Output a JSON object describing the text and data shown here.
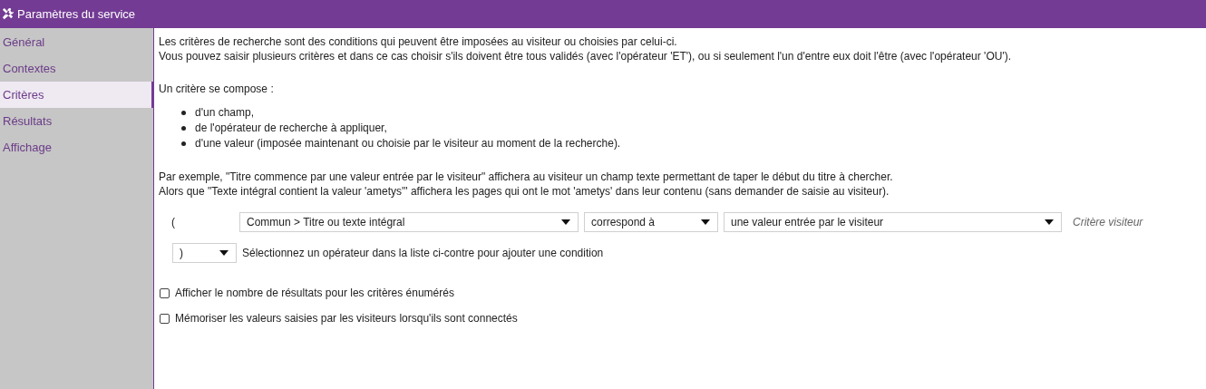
{
  "window": {
    "title": "Paramètres du service"
  },
  "sidebar": {
    "items": [
      {
        "label": "Général",
        "selected": false
      },
      {
        "label": "Contextes",
        "selected": false
      },
      {
        "label": "Critères",
        "selected": true
      },
      {
        "label": "Résultats",
        "selected": false
      },
      {
        "label": "Affichage",
        "selected": false
      }
    ]
  },
  "intro": [
    "Les critères de recherche sont des conditions qui peuvent être imposées au visiteur ou choisies par celui-ci.",
    "Vous pouvez saisir plusieurs critères et dans ce cas choisir s'ils doivent être tous validés (avec l'opérateur 'ET'), ou si seulement l'un d'entre eux doit l'être (avec l'opérateur 'OU')."
  ],
  "composition": {
    "heading": "Un critère se compose :",
    "items": [
      "d'un champ,",
      "de l'opérateur de recherche à appliquer,",
      "d'une valeur (imposée maintenant ou choisie par le visiteur au moment de la recherche)."
    ]
  },
  "example": [
    "Par exemple, \"Titre commence par une valeur entrée par le visiteur\" affichera au visiteur un champ texte permettant de taper le début du titre à chercher.",
    "Alors que \"Texte intégral contient la valeur 'ametys'\" affichera les pages qui ont le mot 'ametys' dans leur contenu (sans demander de saisie au visiteur)."
  ],
  "criterion": {
    "open_paren": "(",
    "field": "Commun > Titre ou texte intégral",
    "operator": "correspond à",
    "value": "une valeur entrée par le visiteur",
    "note": "Critère visiteur"
  },
  "close_row": {
    "operator": ")",
    "hint": "Sélectionnez un opérateur dans la liste ci-contre pour ajouter une condition"
  },
  "options": [
    {
      "label": "Afficher le nombre de résultats pour les critères énumérés",
      "checked": false
    },
    {
      "label": "Mémoriser les valeurs saisies par les visiteurs lorsqu'ils sont connectés",
      "checked": false
    }
  ]
}
